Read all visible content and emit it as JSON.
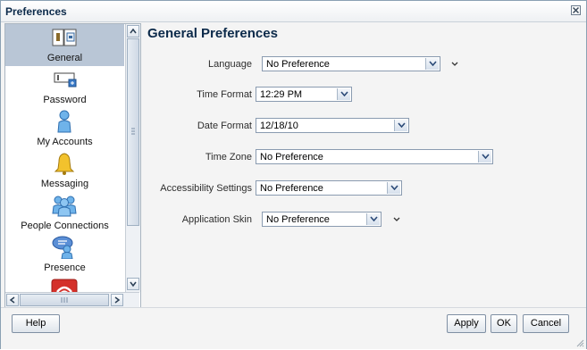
{
  "dialog": {
    "title": "Preferences"
  },
  "sidebar": {
    "items": [
      {
        "label": "General",
        "icon": "general-settings-icon",
        "selected": true
      },
      {
        "label": "Password",
        "icon": "password-icon",
        "selected": false
      },
      {
        "label": "My Accounts",
        "icon": "person-icon",
        "selected": false
      },
      {
        "label": "Messaging",
        "icon": "bell-icon",
        "selected": false
      },
      {
        "label": "People Connections",
        "icon": "people-icon",
        "selected": false
      },
      {
        "label": "Presence",
        "icon": "presence-icon",
        "selected": false
      }
    ]
  },
  "main": {
    "heading": "General Preferences",
    "fields": [
      {
        "label": "Language",
        "value": "No Preference"
      },
      {
        "label": "Time Format",
        "value": "12:29 PM"
      },
      {
        "label": "Date Format",
        "value": "12/18/10"
      },
      {
        "label": "Time Zone",
        "value": "No Preference"
      },
      {
        "label": "Accessibility Settings",
        "value": "No Preference"
      },
      {
        "label": "Application Skin",
        "value": "No Preference"
      }
    ]
  },
  "footer": {
    "help_label": "Help",
    "apply_label": "Apply",
    "ok_label": "OK",
    "cancel_label": "Cancel"
  },
  "colors": {
    "accent": "#0c2a4a",
    "selected_bg": "#b9c6d6"
  }
}
